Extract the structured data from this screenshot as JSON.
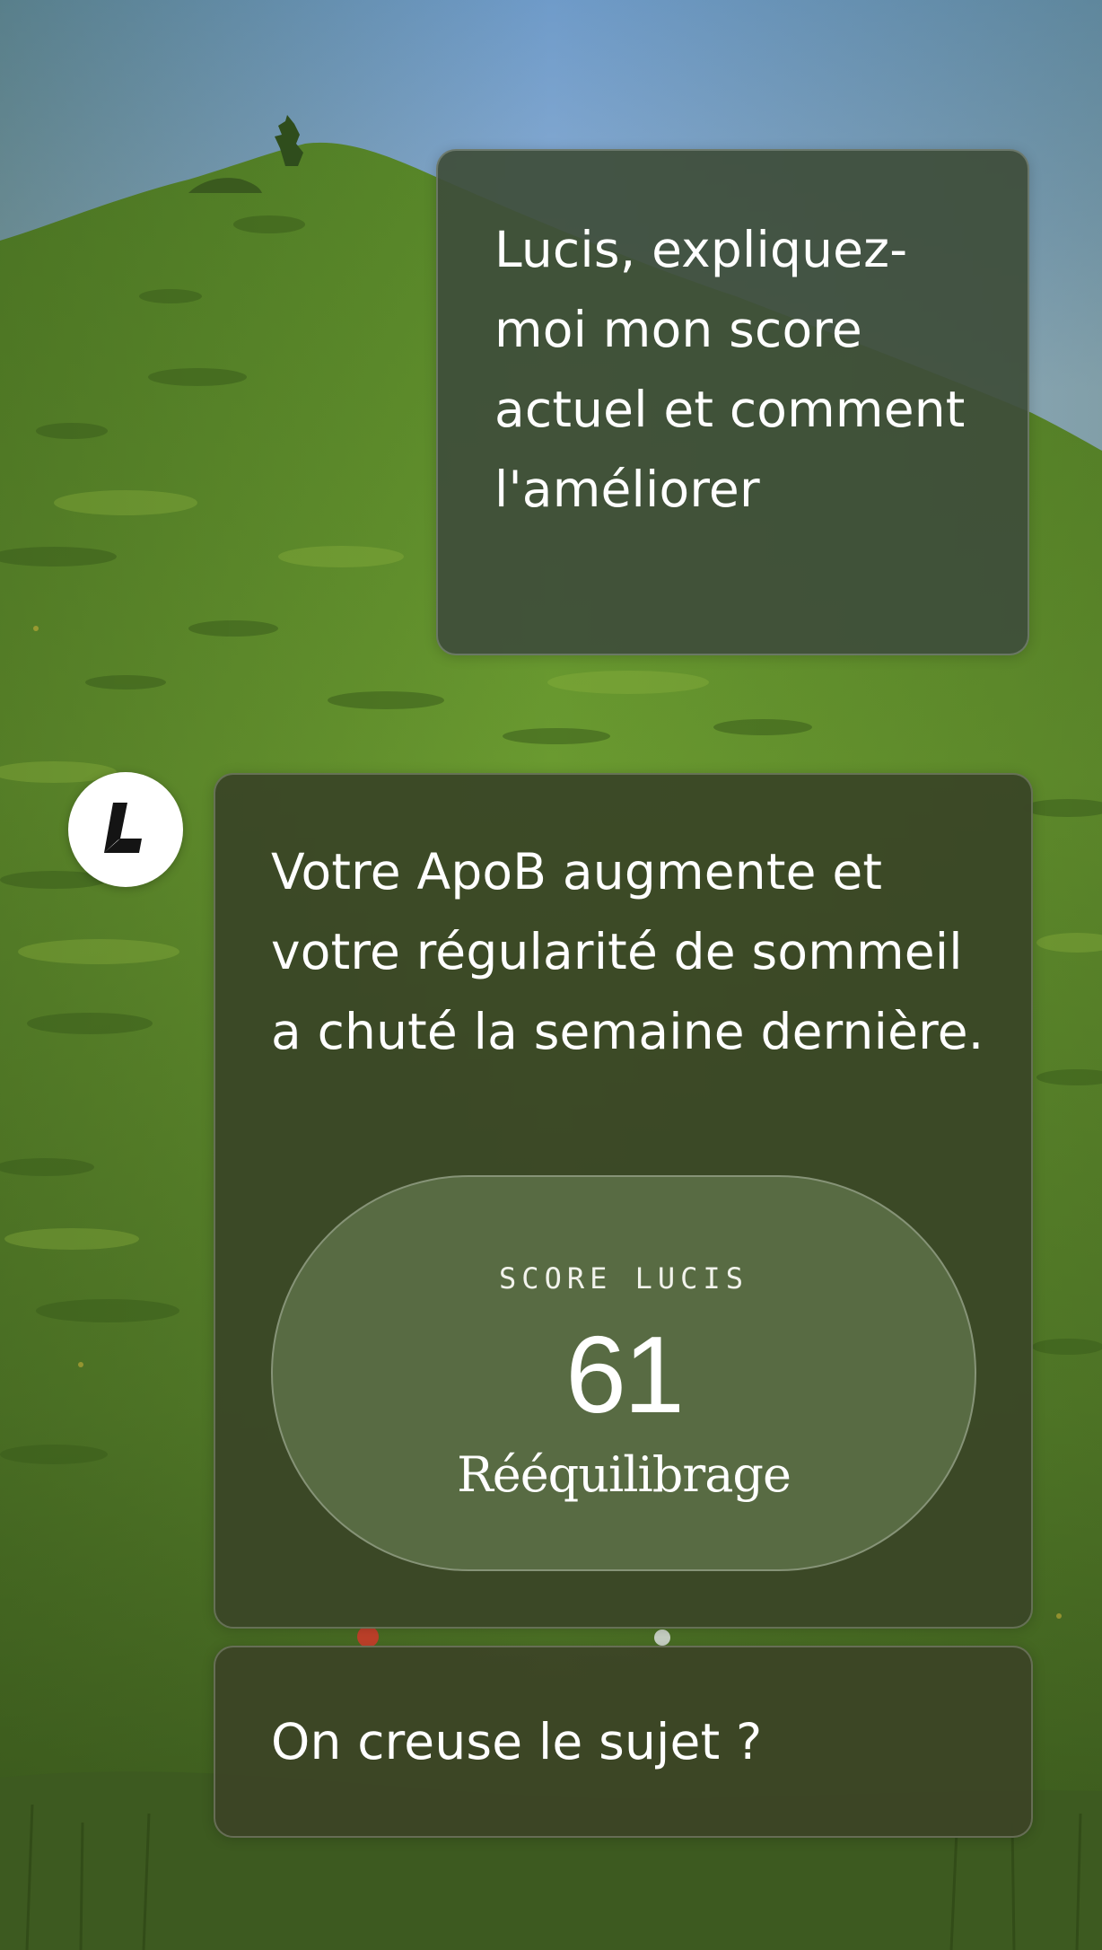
{
  "conversation": {
    "user_message": "Lucis, expliquez-moi mon score actuel et comment l'améliorer",
    "assistant_message": "Votre ApoB augmente et votre régularité de sommeil a chuté la semaine dernière.",
    "score_card": {
      "label": "SCORE LUCIS",
      "value": "61",
      "status": "Rééquilibrage"
    },
    "followup_message": "On creuse le sujet ?"
  },
  "assistant": {
    "avatar_icon": "lucis-logo-icon"
  },
  "colors": {
    "user_bubble": "#3e4e3a",
    "assistant_bubble": "#3a4726",
    "score_pill": "#60744c",
    "sky": "#88acd3",
    "grass": "#5f8a2c"
  }
}
